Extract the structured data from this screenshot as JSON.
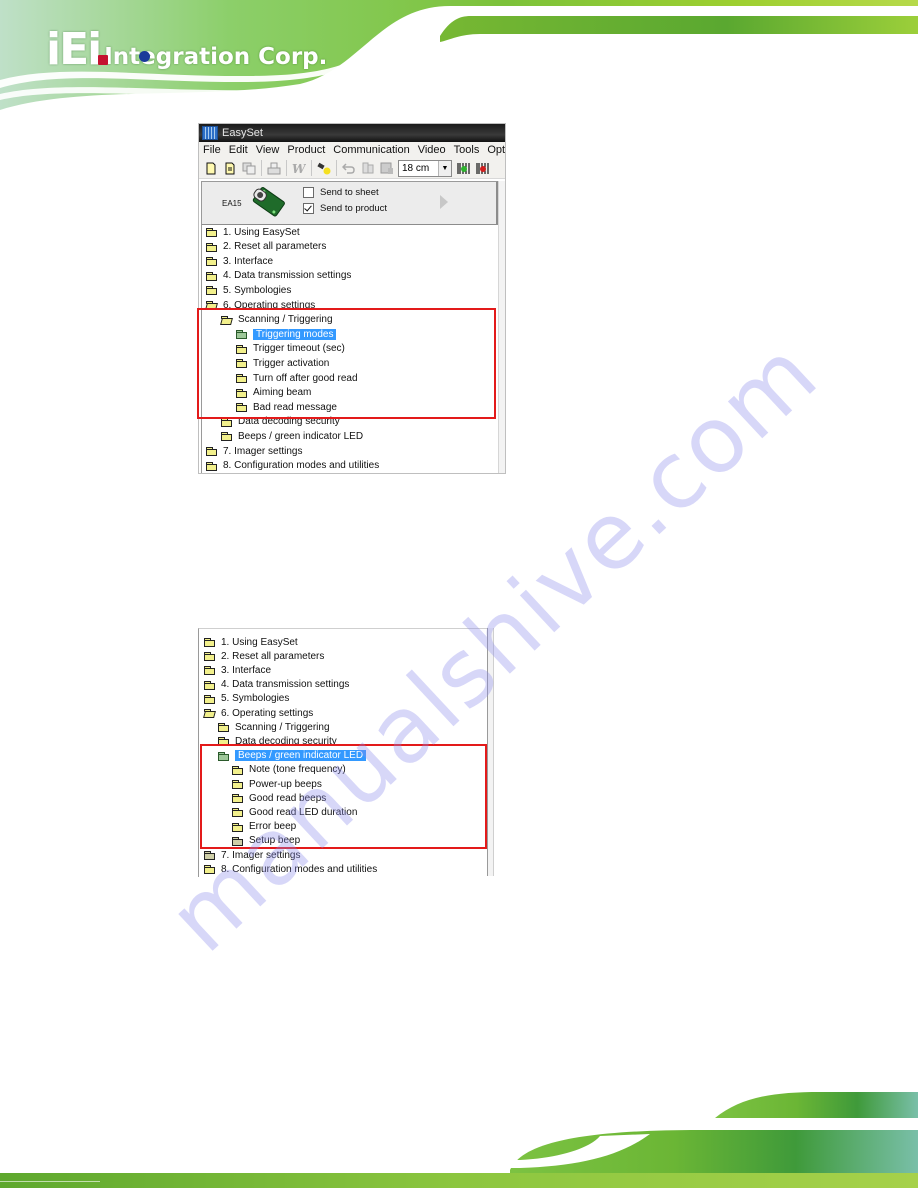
{
  "header": {
    "logo_mark": "iEi",
    "logo_text": "Integration Corp.",
    "colors": {
      "banner_green": "#8cc63f",
      "banner_dark": "#3f9a3a",
      "logo_red": "#c4122f",
      "logo_blue": "#1a3a9a"
    }
  },
  "window": {
    "title": "EasySet",
    "menu": [
      "File",
      "Edit",
      "View",
      "Product",
      "Communication",
      "Video",
      "Tools",
      "Opt"
    ],
    "toolbar": {
      "icons": [
        "new-file-icon",
        "open-file-icon",
        "copy-icon",
        "print-icon",
        "word-export-icon",
        "flashlight-icon",
        "undo-icon",
        "find-icon",
        "preview-icon",
        "barcode-green-icon",
        "barcode-red-icon"
      ],
      "size_combo_value": "18 cm"
    },
    "product_panel": {
      "product_name": "EA15",
      "send_to_sheet_label": "Send to sheet",
      "send_to_sheet_checked": false,
      "send_to_product_label": "Send to product",
      "send_to_product_checked": true
    },
    "tree": [
      {
        "label": "1. Using EasySet",
        "level": 0,
        "state": "closed"
      },
      {
        "label": "2. Reset all parameters",
        "level": 0,
        "state": "closed"
      },
      {
        "label": "3. Interface",
        "level": 0,
        "state": "closed"
      },
      {
        "label": "4. Data transmission settings",
        "level": 0,
        "state": "closed"
      },
      {
        "label": "5. Symbologies",
        "level": 0,
        "state": "closed"
      },
      {
        "label": "6. Operating settings",
        "level": 0,
        "state": "open"
      },
      {
        "label": "Scanning / Triggering",
        "level": 1,
        "state": "open"
      },
      {
        "label": "Triggering modes",
        "level": 2,
        "state": "selected"
      },
      {
        "label": "Trigger timeout (sec)",
        "level": 2,
        "state": "closed"
      },
      {
        "label": "Trigger activation",
        "level": 2,
        "state": "closed"
      },
      {
        "label": "Turn off after good read",
        "level": 2,
        "state": "closed"
      },
      {
        "label": "Aiming beam",
        "level": 2,
        "state": "closed"
      },
      {
        "label": "Bad read message",
        "level": 2,
        "state": "closed"
      },
      {
        "label": "Data decoding security",
        "level": 1,
        "state": "closed"
      },
      {
        "label": "Beeps / green indicator LED",
        "level": 1,
        "state": "closed"
      },
      {
        "label": "7. Imager settings",
        "level": 0,
        "state": "closed"
      },
      {
        "label": "8. Configuration modes and utilities",
        "level": 0,
        "state": "closed"
      }
    ]
  },
  "tree2": [
    {
      "label": "1. Using EasySet",
      "level": 0,
      "state": "closed"
    },
    {
      "label": "2. Reset all parameters",
      "level": 0,
      "state": "closed"
    },
    {
      "label": "3. Interface",
      "level": 0,
      "state": "closed"
    },
    {
      "label": "4. Data transmission settings",
      "level": 0,
      "state": "closed"
    },
    {
      "label": "5. Symbologies",
      "level": 0,
      "state": "closed"
    },
    {
      "label": "6. Operating settings",
      "level": 0,
      "state": "open"
    },
    {
      "label": "Scanning / Triggering",
      "level": 1,
      "state": "closed"
    },
    {
      "label": "Data decoding security",
      "level": 1,
      "state": "closed"
    },
    {
      "label": "Beeps / green indicator LED",
      "level": 1,
      "state": "selected"
    },
    {
      "label": "Note (tone frequency)",
      "level": 2,
      "state": "closed"
    },
    {
      "label": "Power-up beeps",
      "level": 2,
      "state": "closed"
    },
    {
      "label": "Good read beeps",
      "level": 2,
      "state": "closed"
    },
    {
      "label": "Good read LED duration",
      "level": 2,
      "state": "closed"
    },
    {
      "label": "Error beep",
      "level": 2,
      "state": "closed"
    },
    {
      "label": "Setup beep",
      "level": 2,
      "state": "closed"
    },
    {
      "label": "7. Imager settings",
      "level": 0,
      "state": "closed"
    },
    {
      "label": "8. Configuration modes and utilities",
      "level": 0,
      "state": "closed"
    }
  ],
  "highlight_color": "#e31a1a",
  "selection_color": "#3399ff",
  "watermark": "manualshive.com"
}
